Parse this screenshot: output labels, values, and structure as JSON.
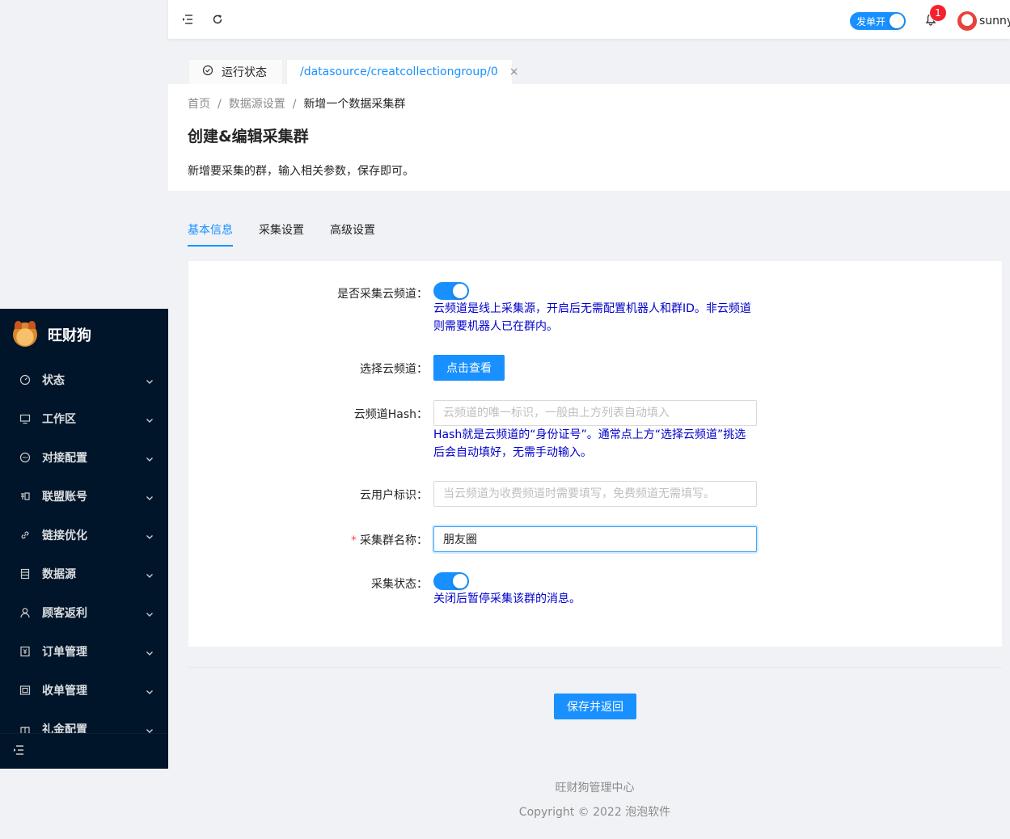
{
  "app": {
    "name": "旺财狗"
  },
  "header": {
    "order_switch_label": "发单开",
    "notification_count": "1",
    "username": "sunny"
  },
  "tabs": [
    {
      "label": "运行状态"
    },
    {
      "label": "/datasource/creatcollectiongroup/0",
      "close": "×"
    }
  ],
  "sidebar": {
    "items": [
      {
        "label": "状态"
      },
      {
        "label": "工作区"
      },
      {
        "label": "对接配置"
      },
      {
        "label": "联盟账号"
      },
      {
        "label": "链接优化"
      },
      {
        "label": "数据源"
      },
      {
        "label": "顾客返利"
      },
      {
        "label": "订单管理"
      },
      {
        "label": "收单管理"
      },
      {
        "label": "礼金配置"
      }
    ]
  },
  "breadcrumb": {
    "home": "首页",
    "parent": "数据源设置",
    "current": "新增一个数据采集群",
    "sep": "/"
  },
  "page": {
    "title": "创建&编辑采集群",
    "description": "新增要采集的群，输入相关参数，保存即可。"
  },
  "content_tabs": [
    {
      "label": "基本信息"
    },
    {
      "label": "采集设置"
    },
    {
      "label": "高级设置"
    }
  ],
  "form": {
    "cloud_channel": {
      "label": "是否采集云频道：",
      "enabled": true,
      "help": "云频道是线上采集源，开启后无需配置机器人和群ID。非云频道则需要机器人已在群内。"
    },
    "select_channel": {
      "label": "选择云频道：",
      "button": "点击查看"
    },
    "hash": {
      "label": "云频道Hash：",
      "value": "",
      "placeholder": "云频道的唯一标识，一般由上方列表自动填入",
      "help": "Hash就是云频道的“身份证号”。通常点上方“选择云频道”挑选后会自动填好，无需手动输入。"
    },
    "user_id": {
      "label": "云用户标识：",
      "value": "",
      "placeholder": "当云频道为收费频道时需要填写，免费频道无需填写。"
    },
    "group_name": {
      "label": "采集群名称：",
      "required_mark": "*",
      "value": "朋友圈"
    },
    "status": {
      "label": "采集状态：",
      "enabled": true,
      "help": "关闭后暂停采集该群的消息。"
    },
    "save_button": "保存并返回"
  },
  "footer": {
    "name": "旺财狗管理中心",
    "copyright": "Copyright © 2022 泡泡软件"
  }
}
